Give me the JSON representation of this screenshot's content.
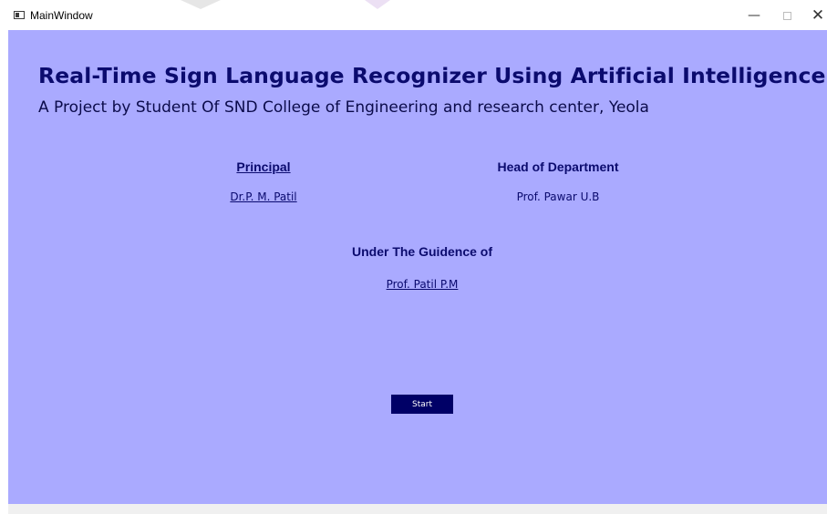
{
  "window": {
    "title": "MainWindow",
    "controls": {
      "minimize": "—",
      "close": "✕"
    }
  },
  "header": {
    "title": "Real-Time Sign Language Recognizer Using Artificial Intelligence",
    "subtitle": "A Project by Student Of SND College of Engineering and research center, Yeola"
  },
  "principal": {
    "heading": "Principal",
    "name": "Dr.P. M. Patil"
  },
  "hod": {
    "heading": "Head of Department",
    "name": "Prof. Pawar U.B"
  },
  "guide": {
    "heading": "Under The Guidence of",
    "name": "Prof. Patil P.M"
  },
  "start_button": {
    "label": "Start"
  },
  "colors": {
    "background": "#aaaaff",
    "text": "#0b0b6e",
    "button": "#000066",
    "button_text": "#ffffff"
  }
}
